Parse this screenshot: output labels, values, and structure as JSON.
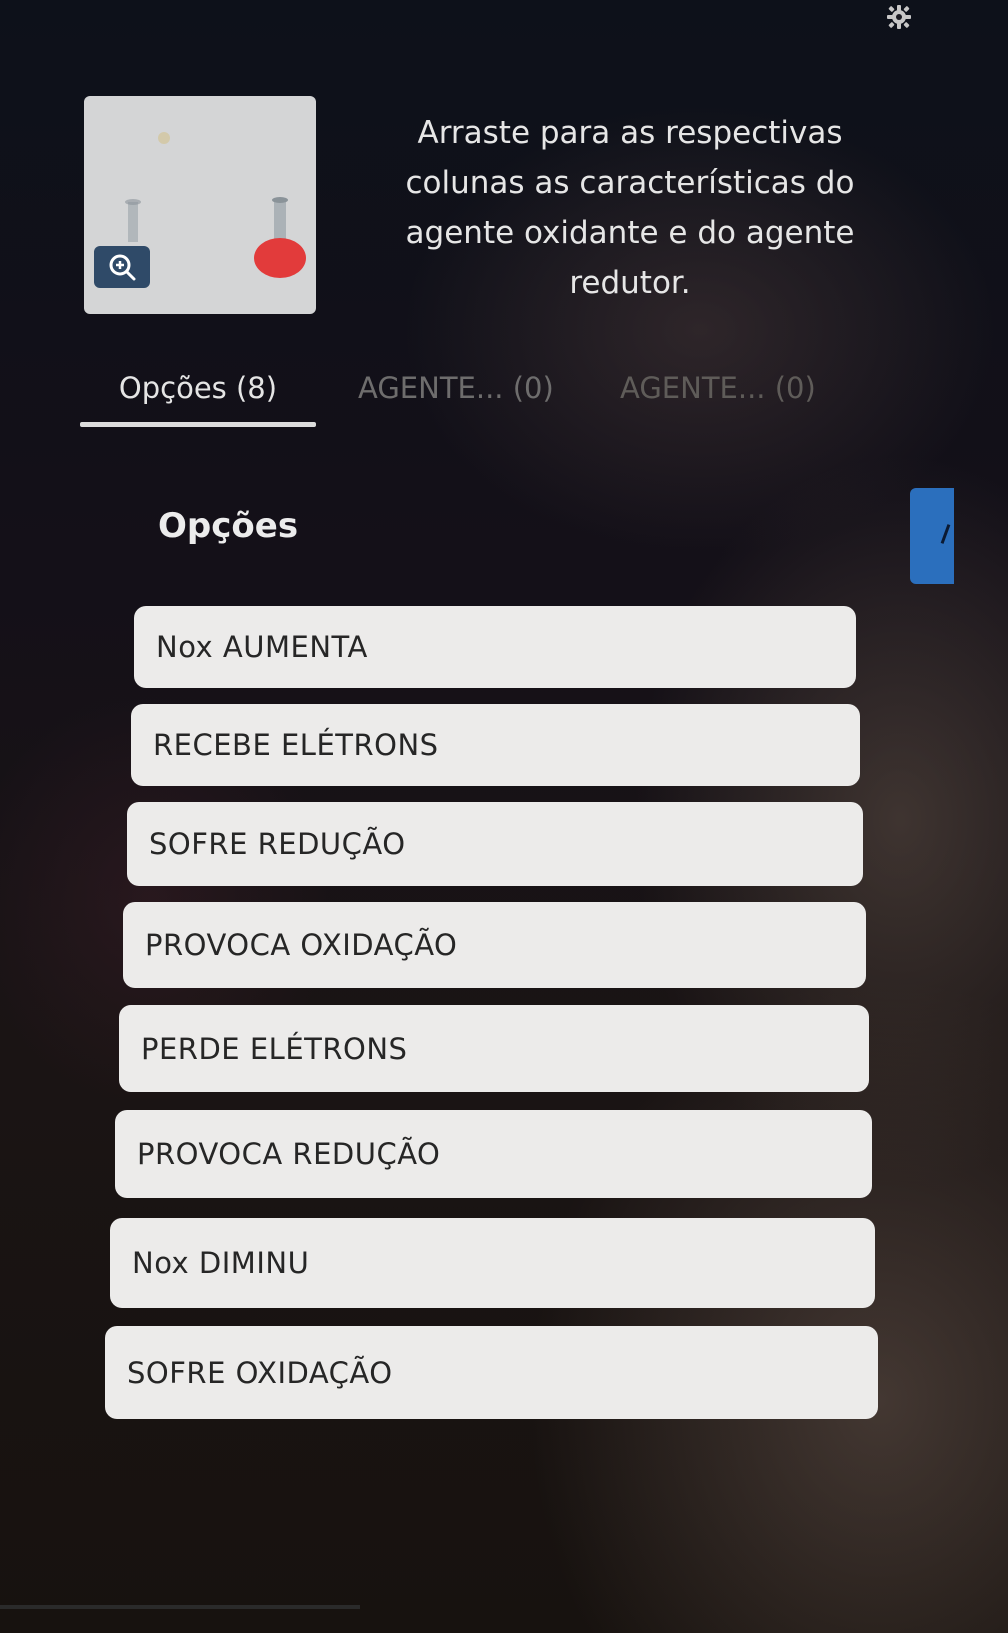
{
  "instructions": "Arraste para as respectivas colunas as características do agente oxidante e do agente redutor.",
  "tabs": [
    {
      "label": "Opções (8)",
      "active": true
    },
    {
      "label": "AGENTE... (0)",
      "active": false
    },
    {
      "label": "AGENTE... (0)",
      "active": false
    }
  ],
  "section_title": "Opções",
  "options": [
    "Nox AUMENTA",
    "RECEBE ELÉTRONS",
    "SOFRE REDUÇÃO",
    "PROVOCA OXIDAÇÃO",
    "PERDE ELÉTRONS",
    "PROVOCA REDUÇÃO",
    "Nox DIMINU",
    "SOFRE OXIDAÇÃO"
  ],
  "icons": {
    "settings": "gear-icon",
    "zoom": "zoom-in-icon",
    "side_handle": "edit-pencil-icon"
  },
  "colors": {
    "accent_blue": "#2b6fbd",
    "zoom_button": "#2f4a68",
    "flask_liquid": "#e23b3b",
    "option_bg": "#ecebea"
  }
}
